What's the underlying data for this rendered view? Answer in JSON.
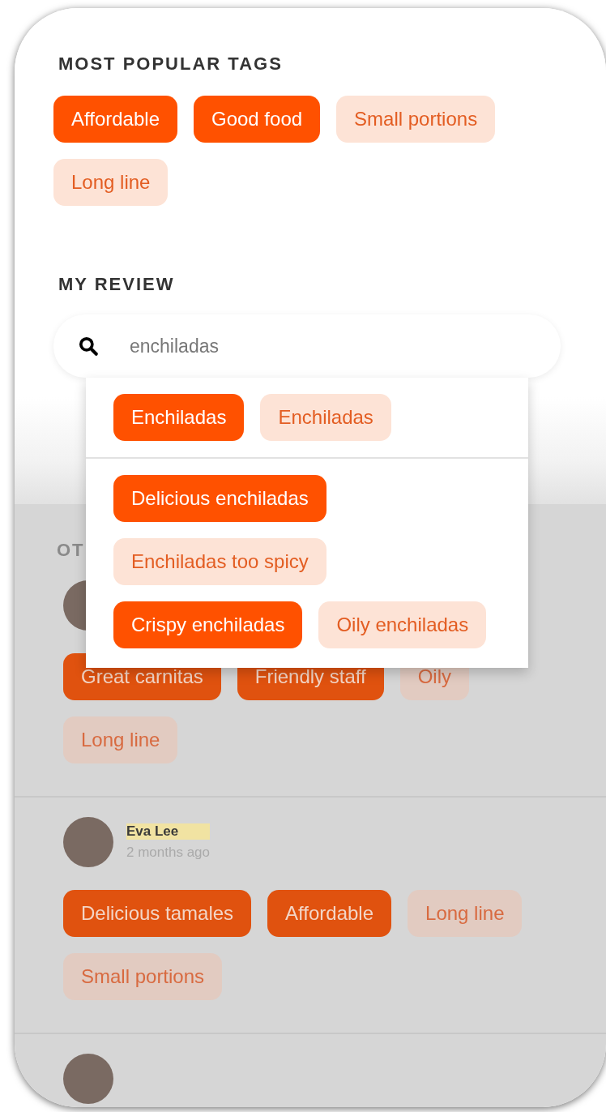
{
  "popular": {
    "title": "MOST POPULAR TAGS",
    "tags": [
      {
        "label": "Affordable",
        "selected": true
      },
      {
        "label": "Good food",
        "selected": true
      },
      {
        "label": "Small portions",
        "selected": false
      },
      {
        "label": "Long line",
        "selected": false
      }
    ]
  },
  "my_review": {
    "title": "MY REVIEW",
    "search": {
      "value": "enchiladas"
    },
    "suggestions": {
      "exact": [
        {
          "label": "Enchiladas",
          "selected": true
        },
        {
          "label": "Enchiladas",
          "selected": false
        }
      ],
      "related": [
        {
          "label": "Delicious enchiladas",
          "selected": true
        },
        {
          "label": "Enchiladas too spicy",
          "selected": false
        },
        {
          "label": "Crispy enchiladas",
          "selected": true
        },
        {
          "label": "Oily enchiladas",
          "selected": false
        }
      ]
    }
  },
  "other_reviews": {
    "title": "OT",
    "reviews": [
      {
        "tags": [
          {
            "label": "Great carnitas",
            "selected": true
          },
          {
            "label": "Friendly staff",
            "selected": true
          },
          {
            "label": "Oily",
            "selected": false
          },
          {
            "label": "Long line",
            "selected": false
          }
        ]
      },
      {
        "name": "Eva Lee",
        "highlighted": true,
        "time": "2 months ago",
        "tags": [
          {
            "label": "Delicious tamales",
            "selected": true
          },
          {
            "label": "Affordable",
            "selected": true
          },
          {
            "label": "Long line",
            "selected": false
          },
          {
            "label": "Small portions",
            "selected": false
          }
        ]
      }
    ]
  }
}
